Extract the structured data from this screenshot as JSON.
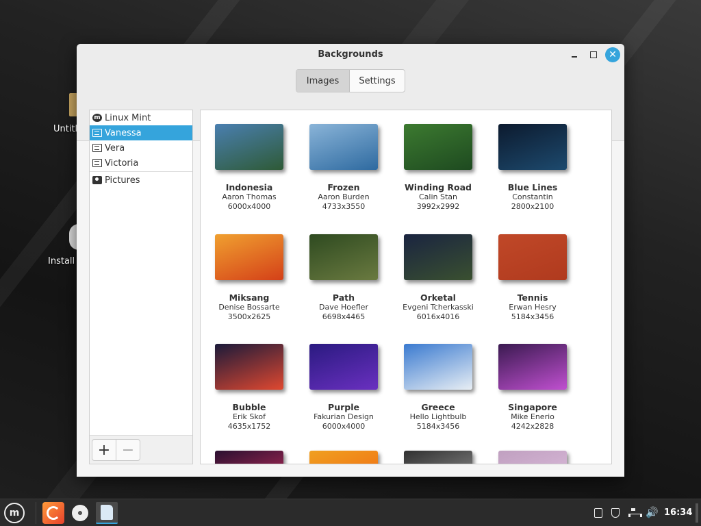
{
  "desktop": {
    "icons": [
      {
        "label": "Untitl"
      },
      {
        "label": "Install"
      }
    ]
  },
  "window": {
    "title": "Backgrounds",
    "controls": {
      "minimize": "minimize",
      "maximize": "maximize",
      "close": "✕"
    }
  },
  "tabs": [
    {
      "label": "Images",
      "active": true
    },
    {
      "label": "Settings",
      "active": false
    }
  ],
  "sidebar": {
    "items": [
      {
        "label": "Linux Mint",
        "icon": "mint-logo-icon",
        "selected": false
      },
      {
        "label": "Vanessa",
        "icon": "monitor-icon",
        "selected": true
      },
      {
        "label": "Vera",
        "icon": "monitor-icon",
        "selected": false
      },
      {
        "label": "Victoria",
        "icon": "monitor-icon",
        "selected": false
      },
      {
        "label": "Pictures",
        "icon": "camera-icon",
        "selected": false
      }
    ],
    "add_label": "+",
    "remove_label": "−"
  },
  "wallpapers": [
    {
      "name": "Indonesia",
      "author": "Aaron Thomas",
      "size": "6000x4000",
      "colors": [
        "#4a7fb0",
        "#2e5a36"
      ]
    },
    {
      "name": "Frozen",
      "author": "Aaron Burden",
      "size": "4733x3550",
      "colors": [
        "#8ab4d8",
        "#2e6aa0"
      ]
    },
    {
      "name": "Winding Road",
      "author": "Calin Stan",
      "size": "3992x2992",
      "colors": [
        "#3c7a30",
        "#1e4a20"
      ]
    },
    {
      "name": "Blue Lines",
      "author": "Constantin",
      "size": "2800x2100",
      "colors": [
        "#0c1a2e",
        "#1d4a6e"
      ]
    },
    {
      "name": "Miksang",
      "author": "Denise Bossarte",
      "size": "3500x2625",
      "colors": [
        "#f0a030",
        "#d44018"
      ]
    },
    {
      "name": "Path",
      "author": "Dave Hoefler",
      "size": "6698x4465",
      "colors": [
        "#2e4a20",
        "#6a7a40"
      ]
    },
    {
      "name": "Orketal",
      "author": "Evgeni Tcherkasski",
      "size": "6016x4016",
      "colors": [
        "#1a2440",
        "#3a5030"
      ]
    },
    {
      "name": "Tennis",
      "author": "Erwan Hesry",
      "size": "5184x3456",
      "colors": [
        "#c04828",
        "#b03a1e"
      ]
    },
    {
      "name": "Bubble",
      "author": "Erik Skof",
      "size": "4635x1752",
      "colors": [
        "#1a1a3a",
        "#e04830"
      ]
    },
    {
      "name": "Purple",
      "author": "Fakurian Design",
      "size": "6000x4000",
      "colors": [
        "#2a1a80",
        "#6a30c0"
      ]
    },
    {
      "name": "Greece",
      "author": "Hello Lightbulb",
      "size": "5184x3456",
      "colors": [
        "#3a7ad0",
        "#e8eef4"
      ]
    },
    {
      "name": "Singapore",
      "author": "Mike Enerio",
      "size": "4242x2828",
      "colors": [
        "#3a1a50",
        "#c050d0"
      ]
    },
    {
      "name": "",
      "author": "",
      "size": "",
      "colors": [
        "#2a1030",
        "#d03060"
      ]
    },
    {
      "name": "",
      "author": "",
      "size": "",
      "colors": [
        "#f0a020",
        "#f06010"
      ]
    },
    {
      "name": "",
      "author": "",
      "size": "",
      "colors": [
        "#303030",
        "#a0a0a0"
      ]
    },
    {
      "name": "",
      "author": "",
      "size": "",
      "colors": [
        "#c0a0c0",
        "#e0c0e0"
      ]
    }
  ],
  "taskbar": {
    "menu_label": "m",
    "apps": [
      "firefox-icon",
      "disc-icon",
      "files-icon"
    ],
    "clock": "16:34",
    "volume": "🔊"
  },
  "colors": {
    "accent": "#35a4dc"
  }
}
